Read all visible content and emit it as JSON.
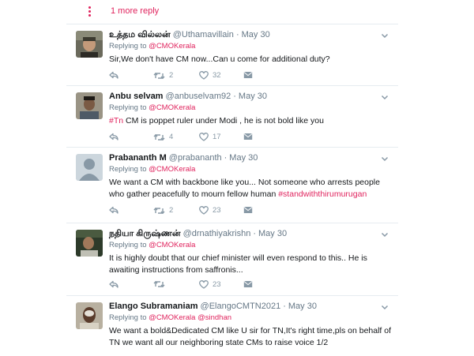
{
  "thread": {
    "more_replies": "1 more reply"
  },
  "tweets": [
    {
      "name": "உத்தம வில்லன்",
      "handle": "@Uthamavillain",
      "time": "May 30",
      "replying_prefix": "Replying to",
      "replying_to": "@CMOKerala",
      "replying_to_2": "",
      "text": [
        {
          "t": "Sir,We don't have CM now...Can u come for additional duty?",
          "h": false
        }
      ],
      "retweets": "2",
      "likes": "32"
    },
    {
      "name": "Anbu selvam",
      "handle": "@anbuselvam92",
      "time": "May 30",
      "replying_prefix": "Replying to",
      "replying_to": "@CMOKerala",
      "replying_to_2": "",
      "text": [
        {
          "t": "#Tn",
          "h": true
        },
        {
          "t": " CM is poppet ruler under Modi , he is not bold like you",
          "h": false
        }
      ],
      "retweets": "4",
      "likes": "17"
    },
    {
      "name": "Prabananth M",
      "handle": "@prabananth",
      "time": "May 30",
      "replying_prefix": "Replying to",
      "replying_to": "@CMOKerala",
      "replying_to_2": "",
      "text": [
        {
          "t": "We want a CM with backbone like you... Not someone who arrests people who gather peacefully to mourn fellow human ",
          "h": false
        },
        {
          "t": "#standwiththirumurugan",
          "h": true
        }
      ],
      "retweets": "2",
      "likes": "23"
    },
    {
      "name": "நதியா கிருஷ்ணன்",
      "handle": "@drnathiyakrishn",
      "time": "May 30",
      "replying_prefix": "Replying to",
      "replying_to": "@CMOKerala",
      "replying_to_2": "",
      "text": [
        {
          "t": "It is highly doubt that our chief minister will even respond to this.. He is awaiting instructions from saffronis...",
          "h": false
        }
      ],
      "retweets": "",
      "likes": "23"
    },
    {
      "name": "Elango Subramaniam",
      "handle": "@ElangoCMTN2021",
      "time": "May 30",
      "replying_prefix": "Replying to",
      "replying_to": "@CMOKerala",
      "replying_to_2": "@sindhan",
      "text": [
        {
          "t": "We want a bold&Dedicated CM like U sir for TN,It's right time,pls on behalf of TN we want all our neighboring state CMs to raise voice 1/2",
          "h": false
        }
      ],
      "retweets": "",
      "likes": ""
    }
  ],
  "colors": {
    "accent": "#e0245e",
    "muted": "#657786",
    "icon": "#8899a6",
    "divider": "#e6ecf0"
  },
  "icons": [
    "more-vertical-icon",
    "chevron-down-icon",
    "reply-icon",
    "retweet-icon",
    "like-icon",
    "direct-message-icon"
  ]
}
